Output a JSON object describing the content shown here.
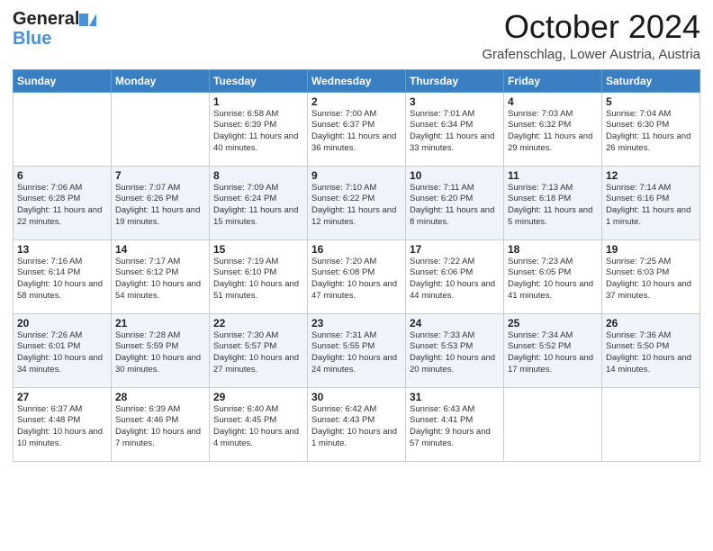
{
  "header": {
    "logo_general": "General",
    "logo_blue": "Blue",
    "title": "October 2024",
    "location": "Grafenschlag, Lower Austria, Austria"
  },
  "days_of_week": [
    "Sunday",
    "Monday",
    "Tuesday",
    "Wednesday",
    "Thursday",
    "Friday",
    "Saturday"
  ],
  "weeks": [
    [
      {
        "day": "",
        "sunrise": "",
        "sunset": "",
        "daylight": ""
      },
      {
        "day": "",
        "sunrise": "",
        "sunset": "",
        "daylight": ""
      },
      {
        "day": "1",
        "sunrise": "Sunrise: 6:58 AM",
        "sunset": "Sunset: 6:39 PM",
        "daylight": "Daylight: 11 hours and 40 minutes."
      },
      {
        "day": "2",
        "sunrise": "Sunrise: 7:00 AM",
        "sunset": "Sunset: 6:37 PM",
        "daylight": "Daylight: 11 hours and 36 minutes."
      },
      {
        "day": "3",
        "sunrise": "Sunrise: 7:01 AM",
        "sunset": "Sunset: 6:34 PM",
        "daylight": "Daylight: 11 hours and 33 minutes."
      },
      {
        "day": "4",
        "sunrise": "Sunrise: 7:03 AM",
        "sunset": "Sunset: 6:32 PM",
        "daylight": "Daylight: 11 hours and 29 minutes."
      },
      {
        "day": "5",
        "sunrise": "Sunrise: 7:04 AM",
        "sunset": "Sunset: 6:30 PM",
        "daylight": "Daylight: 11 hours and 26 minutes."
      }
    ],
    [
      {
        "day": "6",
        "sunrise": "Sunrise: 7:06 AM",
        "sunset": "Sunset: 6:28 PM",
        "daylight": "Daylight: 11 hours and 22 minutes."
      },
      {
        "day": "7",
        "sunrise": "Sunrise: 7:07 AM",
        "sunset": "Sunset: 6:26 PM",
        "daylight": "Daylight: 11 hours and 19 minutes."
      },
      {
        "day": "8",
        "sunrise": "Sunrise: 7:09 AM",
        "sunset": "Sunset: 6:24 PM",
        "daylight": "Daylight: 11 hours and 15 minutes."
      },
      {
        "day": "9",
        "sunrise": "Sunrise: 7:10 AM",
        "sunset": "Sunset: 6:22 PM",
        "daylight": "Daylight: 11 hours and 12 minutes."
      },
      {
        "day": "10",
        "sunrise": "Sunrise: 7:11 AM",
        "sunset": "Sunset: 6:20 PM",
        "daylight": "Daylight: 11 hours and 8 minutes."
      },
      {
        "day": "11",
        "sunrise": "Sunrise: 7:13 AM",
        "sunset": "Sunset: 6:18 PM",
        "daylight": "Daylight: 11 hours and 5 minutes."
      },
      {
        "day": "12",
        "sunrise": "Sunrise: 7:14 AM",
        "sunset": "Sunset: 6:16 PM",
        "daylight": "Daylight: 11 hours and 1 minute."
      }
    ],
    [
      {
        "day": "13",
        "sunrise": "Sunrise: 7:16 AM",
        "sunset": "Sunset: 6:14 PM",
        "daylight": "Daylight: 10 hours and 58 minutes."
      },
      {
        "day": "14",
        "sunrise": "Sunrise: 7:17 AM",
        "sunset": "Sunset: 6:12 PM",
        "daylight": "Daylight: 10 hours and 54 minutes."
      },
      {
        "day": "15",
        "sunrise": "Sunrise: 7:19 AM",
        "sunset": "Sunset: 6:10 PM",
        "daylight": "Daylight: 10 hours and 51 minutes."
      },
      {
        "day": "16",
        "sunrise": "Sunrise: 7:20 AM",
        "sunset": "Sunset: 6:08 PM",
        "daylight": "Daylight: 10 hours and 47 minutes."
      },
      {
        "day": "17",
        "sunrise": "Sunrise: 7:22 AM",
        "sunset": "Sunset: 6:06 PM",
        "daylight": "Daylight: 10 hours and 44 minutes."
      },
      {
        "day": "18",
        "sunrise": "Sunrise: 7:23 AM",
        "sunset": "Sunset: 6:05 PM",
        "daylight": "Daylight: 10 hours and 41 minutes."
      },
      {
        "day": "19",
        "sunrise": "Sunrise: 7:25 AM",
        "sunset": "Sunset: 6:03 PM",
        "daylight": "Daylight: 10 hours and 37 minutes."
      }
    ],
    [
      {
        "day": "20",
        "sunrise": "Sunrise: 7:26 AM",
        "sunset": "Sunset: 6:01 PM",
        "daylight": "Daylight: 10 hours and 34 minutes."
      },
      {
        "day": "21",
        "sunrise": "Sunrise: 7:28 AM",
        "sunset": "Sunset: 5:59 PM",
        "daylight": "Daylight: 10 hours and 30 minutes."
      },
      {
        "day": "22",
        "sunrise": "Sunrise: 7:30 AM",
        "sunset": "Sunset: 5:57 PM",
        "daylight": "Daylight: 10 hours and 27 minutes."
      },
      {
        "day": "23",
        "sunrise": "Sunrise: 7:31 AM",
        "sunset": "Sunset: 5:55 PM",
        "daylight": "Daylight: 10 hours and 24 minutes."
      },
      {
        "day": "24",
        "sunrise": "Sunrise: 7:33 AM",
        "sunset": "Sunset: 5:53 PM",
        "daylight": "Daylight: 10 hours and 20 minutes."
      },
      {
        "day": "25",
        "sunrise": "Sunrise: 7:34 AM",
        "sunset": "Sunset: 5:52 PM",
        "daylight": "Daylight: 10 hours and 17 minutes."
      },
      {
        "day": "26",
        "sunrise": "Sunrise: 7:36 AM",
        "sunset": "Sunset: 5:50 PM",
        "daylight": "Daylight: 10 hours and 14 minutes."
      }
    ],
    [
      {
        "day": "27",
        "sunrise": "Sunrise: 6:37 AM",
        "sunset": "Sunset: 4:48 PM",
        "daylight": "Daylight: 10 hours and 10 minutes."
      },
      {
        "day": "28",
        "sunrise": "Sunrise: 6:39 AM",
        "sunset": "Sunset: 4:46 PM",
        "daylight": "Daylight: 10 hours and 7 minutes."
      },
      {
        "day": "29",
        "sunrise": "Sunrise: 6:40 AM",
        "sunset": "Sunset: 4:45 PM",
        "daylight": "Daylight: 10 hours and 4 minutes."
      },
      {
        "day": "30",
        "sunrise": "Sunrise: 6:42 AM",
        "sunset": "Sunset: 4:43 PM",
        "daylight": "Daylight: 10 hours and 1 minute."
      },
      {
        "day": "31",
        "sunrise": "Sunrise: 6:43 AM",
        "sunset": "Sunset: 4:41 PM",
        "daylight": "Daylight: 9 hours and 57 minutes."
      },
      {
        "day": "",
        "sunrise": "",
        "sunset": "",
        "daylight": ""
      },
      {
        "day": "",
        "sunrise": "",
        "sunset": "",
        "daylight": ""
      }
    ]
  ]
}
